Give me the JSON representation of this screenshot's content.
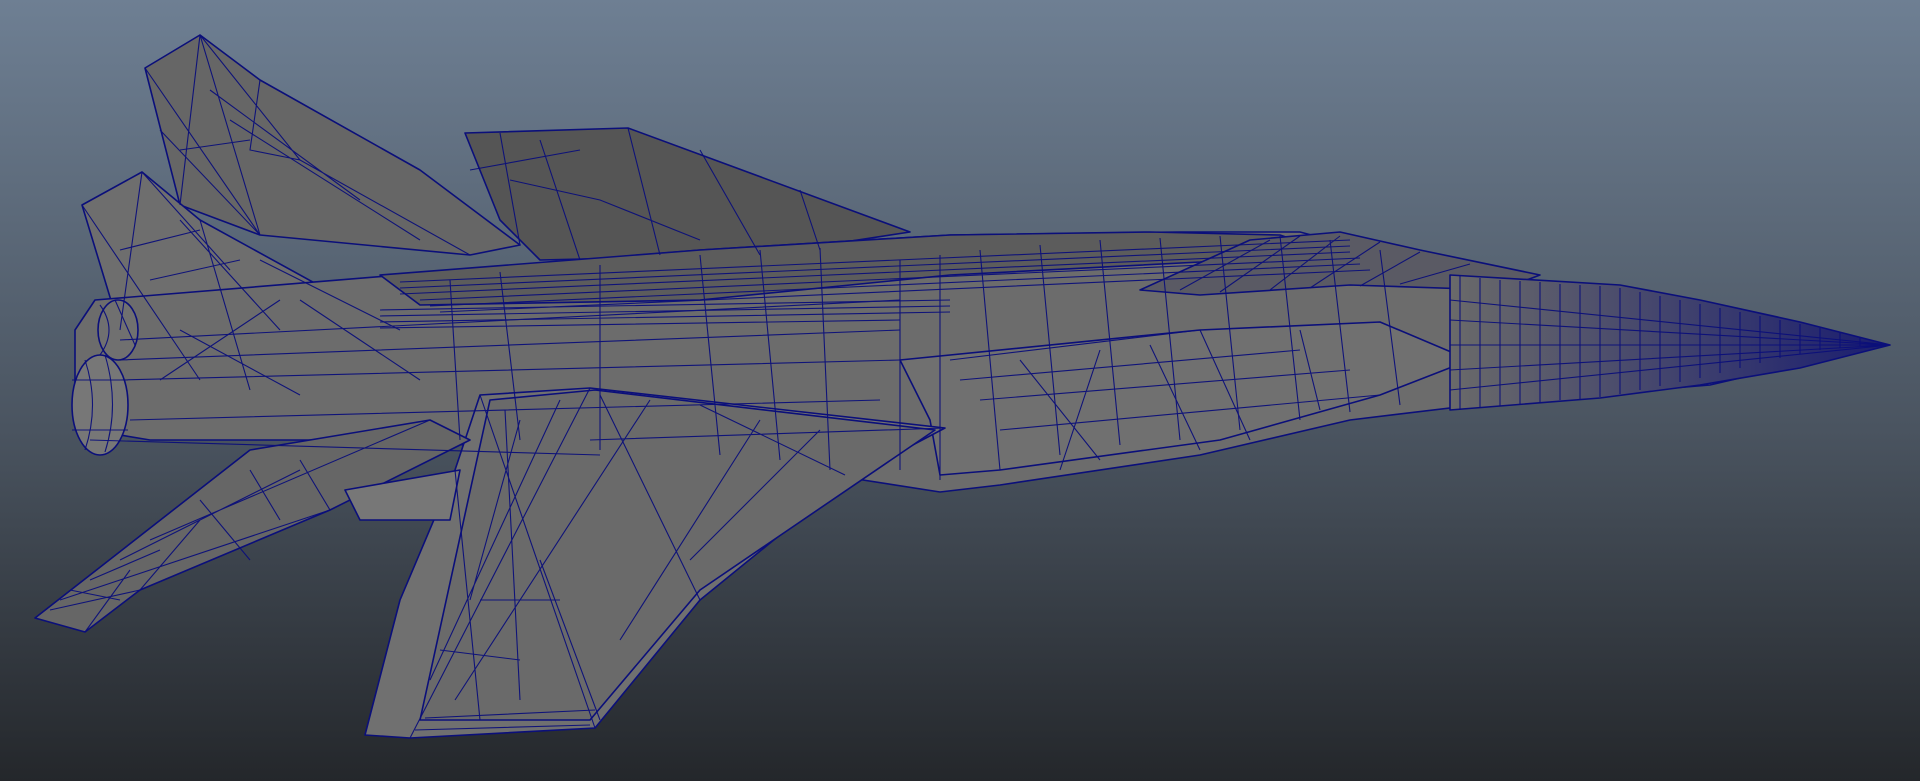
{
  "viewport": {
    "name": "3d-viewport",
    "background_top_color": "#6e7f93",
    "background_bottom_color": "#24272b"
  },
  "model": {
    "subject": "fighter-jet",
    "display_mode": "wireframe-on-shaded",
    "shade_color": "#6b6b6b",
    "shade_dark_color": "#4e4e4e",
    "shade_light_color": "#7d7d7d",
    "wire_color": "#0b0f7a"
  }
}
